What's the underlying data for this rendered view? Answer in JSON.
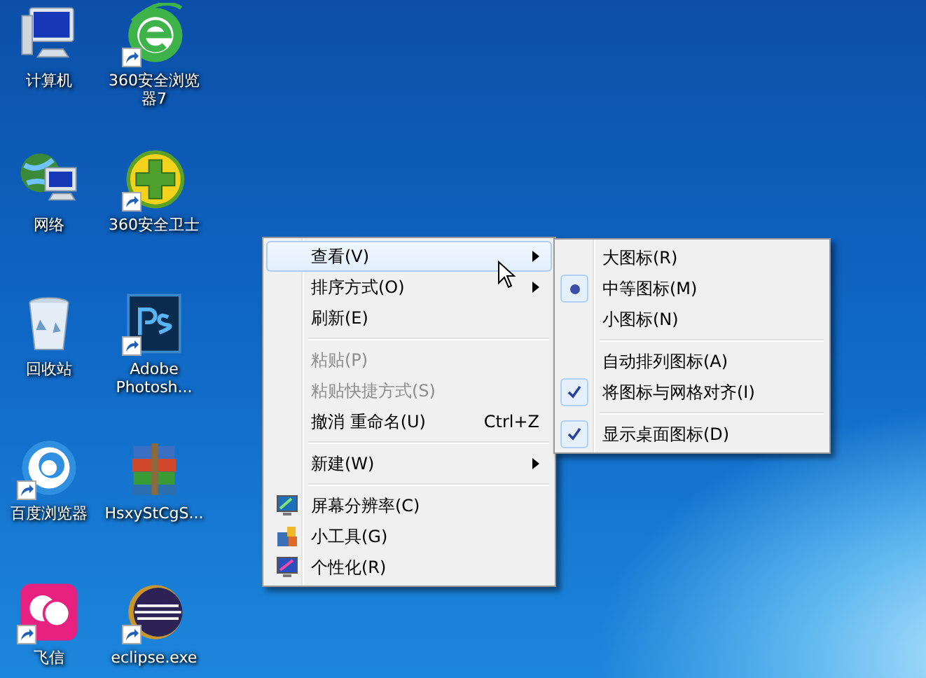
{
  "desktop_icons": [
    {
      "label": "计算机",
      "kind": "computer",
      "shortcut": false
    },
    {
      "label": "360安全浏览器7",
      "kind": "browser",
      "shortcut": true
    },
    {
      "label": "网络",
      "kind": "network",
      "shortcut": false
    },
    {
      "label": "360安全卫士",
      "kind": "guard",
      "shortcut": true
    },
    {
      "label": "回收站",
      "kind": "bin",
      "shortcut": false
    },
    {
      "label": "Adobe Photosh...",
      "kind": "ps",
      "shortcut": true
    },
    {
      "label": "百度浏览器",
      "kind": "baidu",
      "shortcut": true
    },
    {
      "label": "HsxyStCgS...",
      "kind": "archive",
      "shortcut": false
    },
    {
      "label": "飞信",
      "kind": "fetion",
      "shortcut": true
    },
    {
      "label": "eclipse.exe",
      "kind": "eclipse",
      "shortcut": true
    }
  ],
  "context_menu": {
    "items": [
      {
        "kind": "item",
        "label": "查看(V)",
        "submenu": true,
        "selected": true,
        "disabled": false
      },
      {
        "kind": "item",
        "label": "排序方式(O)",
        "submenu": true,
        "selected": false,
        "disabled": false
      },
      {
        "kind": "item",
        "label": "刷新(E)",
        "submenu": false,
        "selected": false,
        "disabled": false
      },
      {
        "kind": "separator"
      },
      {
        "kind": "item",
        "label": "粘贴(P)",
        "submenu": false,
        "selected": false,
        "disabled": true
      },
      {
        "kind": "item",
        "label": "粘贴快捷方式(S)",
        "submenu": false,
        "selected": false,
        "disabled": true
      },
      {
        "kind": "item",
        "label": "撤消 重命名(U)",
        "shortcut": "Ctrl+Z",
        "submenu": false,
        "selected": false,
        "disabled": false
      },
      {
        "kind": "separator"
      },
      {
        "kind": "item",
        "label": "新建(W)",
        "submenu": true,
        "selected": false,
        "disabled": false
      },
      {
        "kind": "separator"
      },
      {
        "kind": "iconitem",
        "label": "屏幕分辨率(C)",
        "submenu": false,
        "selected": false,
        "disabled": false
      },
      {
        "kind": "iconitem",
        "label": "小工具(G)",
        "submenu": false,
        "selected": false,
        "disabled": false
      },
      {
        "kind": "iconitem",
        "label": "个性化(R)",
        "submenu": false,
        "selected": false,
        "disabled": false
      }
    ]
  },
  "view_submenu": {
    "items": [
      {
        "kind": "radio",
        "label": "大图标(R)",
        "selected": false
      },
      {
        "kind": "radio",
        "label": "中等图标(M)",
        "selected": true
      },
      {
        "kind": "radio",
        "label": "小图标(N)",
        "selected": false
      },
      {
        "kind": "separator"
      },
      {
        "kind": "check",
        "label": "自动排列图标(A)",
        "checked": false
      },
      {
        "kind": "check",
        "label": "将图标与网格对齐(I)",
        "checked": true
      },
      {
        "kind": "separator"
      },
      {
        "kind": "check",
        "label": "显示桌面图标(D)",
        "checked": true
      }
    ]
  }
}
